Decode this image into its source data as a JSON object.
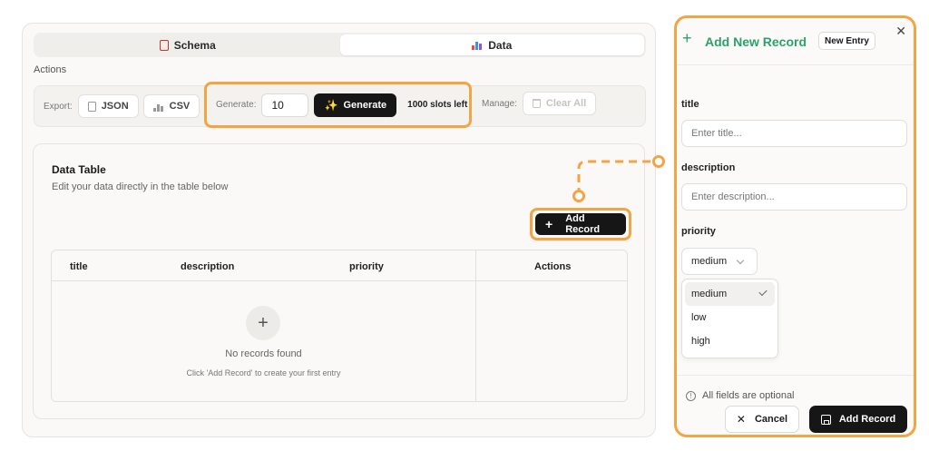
{
  "tabs": [
    {
      "label": "Schema",
      "icon": "document-icon"
    },
    {
      "label": "Data",
      "icon": "chart-icon"
    }
  ],
  "actions": {
    "label": "Actions",
    "export_label": "Export:",
    "json_label": "JSON",
    "csv_label": "CSV",
    "generate_label": "Generate:",
    "generate_count": "10",
    "generate_button": "Generate",
    "slots_left": "1000 slots left",
    "manage_label": "Manage:",
    "clear_all": "Clear All"
  },
  "data_table": {
    "title": "Data Table",
    "subtitle": "Edit your data directly in the table below",
    "add_record": "Add Record",
    "columns": [
      "title",
      "description",
      "priority",
      "Actions"
    ],
    "empty_title": "No records found",
    "empty_hint": "Click 'Add Record' to create your first entry"
  },
  "panel": {
    "title": "Add New Record",
    "badge": "New Entry",
    "fields": [
      {
        "label": "title",
        "placeholder": "Enter title..."
      },
      {
        "label": "description",
        "placeholder": "Enter description..."
      }
    ],
    "priority_label": "priority",
    "priority_value": "medium",
    "priority_options": [
      "medium",
      "low",
      "high"
    ],
    "info": "All fields are optional",
    "cancel": "Cancel",
    "save": "Add Record"
  },
  "colors": {
    "highlight": "#f4a445",
    "accent_green": "#2aa26b",
    "dark_button": "#161616"
  }
}
